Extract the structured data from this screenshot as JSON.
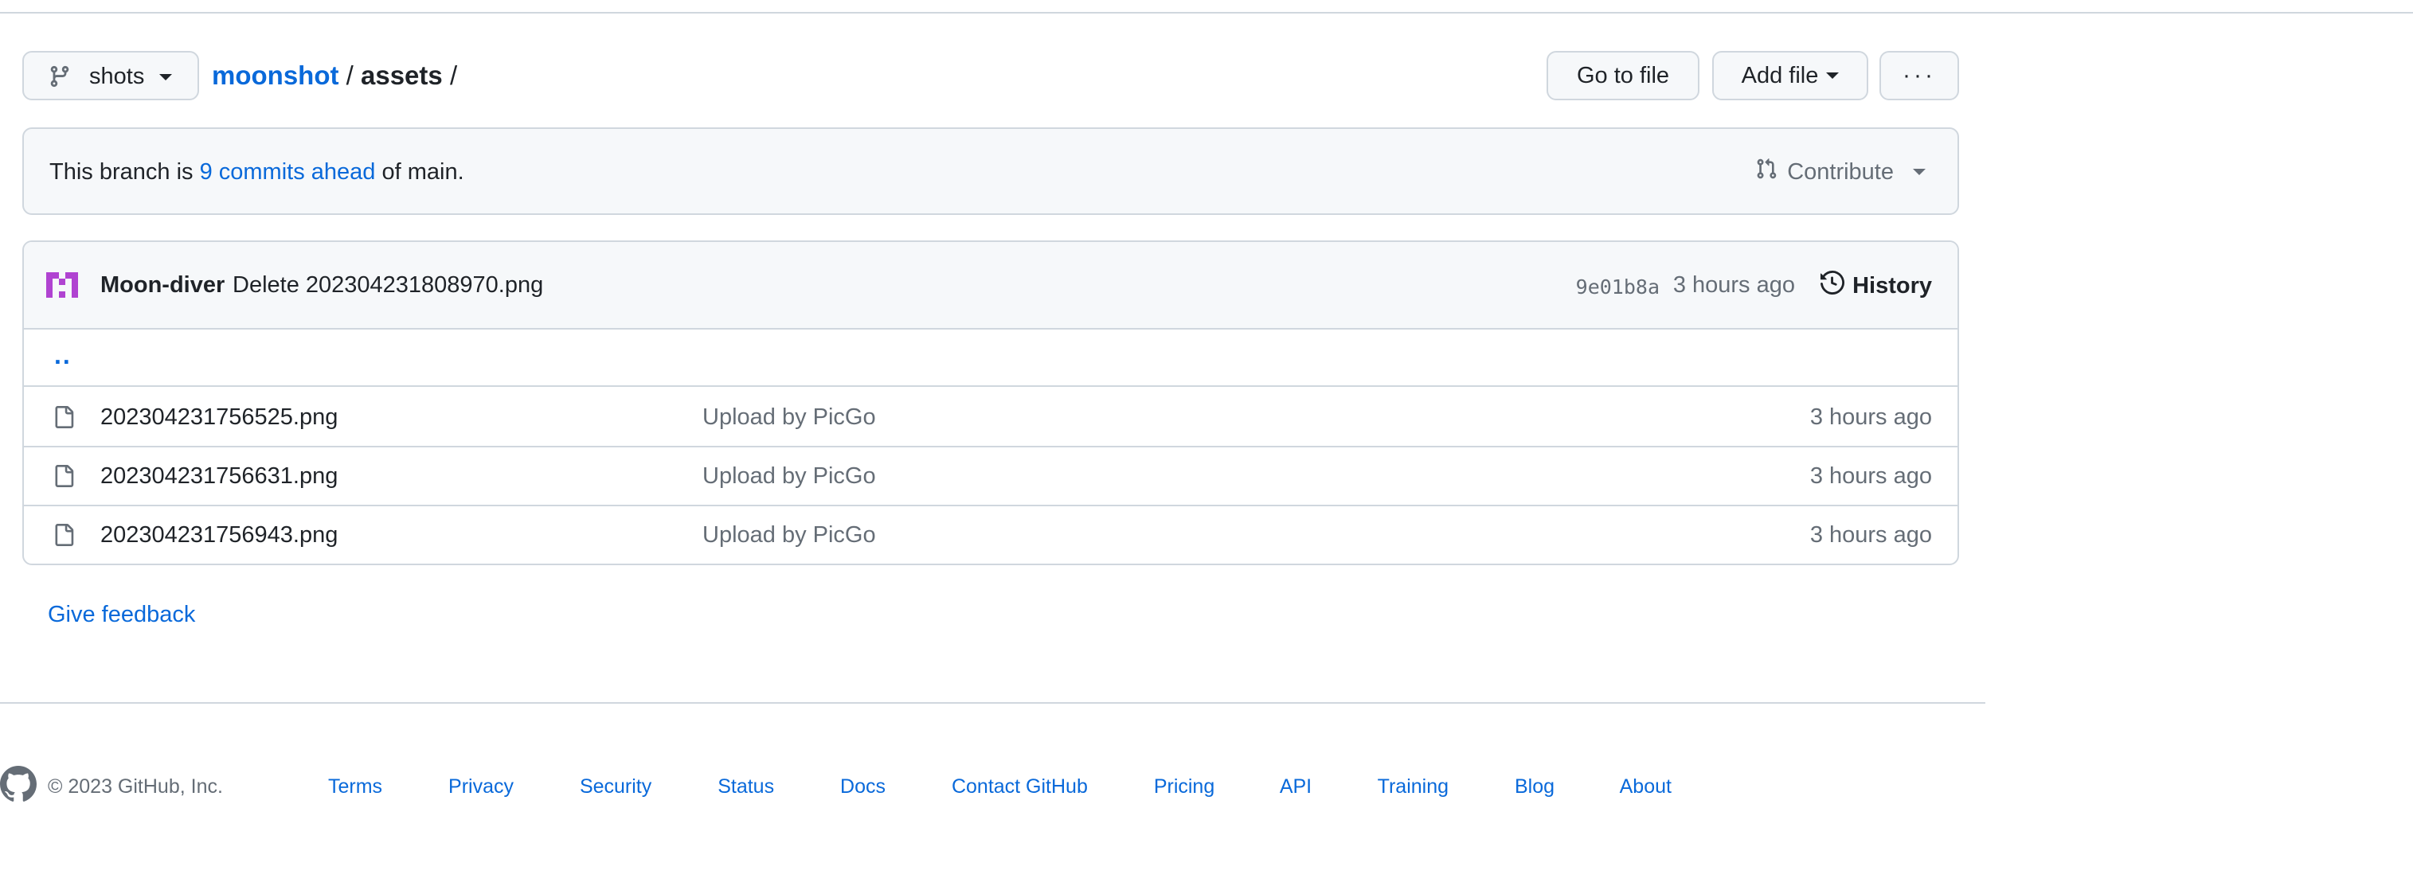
{
  "toolbar": {
    "branch": "shots",
    "breadcrumb": {
      "repo": "moonshot",
      "sep1": "/",
      "folder": "assets",
      "sep2": "/"
    },
    "goto_file": "Go to file",
    "add_file": "Add file",
    "more": "···"
  },
  "banner": {
    "prefix": "This branch is",
    "link": "9 commits ahead",
    "suffix": "of main.",
    "contribute": "Contribute"
  },
  "latest_commit": {
    "author": "Moon-diver",
    "message": "Delete 202304231808970.png",
    "sha": "9e01b8a",
    "time": "3 hours ago",
    "history": "History"
  },
  "files": {
    "parent": "..",
    "items": [
      {
        "name": "202304231756525.png",
        "message": "Upload by PicGo",
        "time": "3 hours ago"
      },
      {
        "name": "202304231756631.png",
        "message": "Upload by PicGo",
        "time": "3 hours ago"
      },
      {
        "name": "202304231756943.png",
        "message": "Upload by PicGo",
        "time": "3 hours ago"
      }
    ]
  },
  "feedback": "Give feedback",
  "footer": {
    "copyright": "© 2023 GitHub, Inc.",
    "links": [
      "Terms",
      "Privacy",
      "Security",
      "Status",
      "Docs",
      "Contact GitHub",
      "Pricing",
      "API",
      "Training",
      "Blog",
      "About"
    ]
  },
  "colors": {
    "link": "#0969da",
    "border": "#d0d7de",
    "muted": "#656d76",
    "avatar": "#b043d1"
  }
}
